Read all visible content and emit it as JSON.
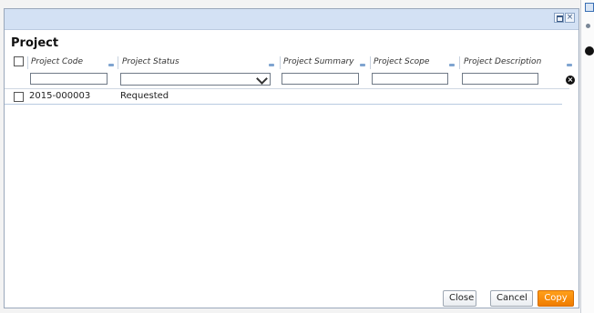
{
  "dialog": {
    "title": "Project",
    "window_buttons": {
      "maximize": "",
      "close": "×"
    }
  },
  "grid": {
    "columns": [
      {
        "label": "Project Code",
        "filter_type": "text",
        "filter_value": ""
      },
      {
        "label": "Project Status",
        "filter_type": "select",
        "filter_value": ""
      },
      {
        "label": "Project Summary",
        "filter_type": "text",
        "filter_value": ""
      },
      {
        "label": "Project Scope",
        "filter_type": "text",
        "filter_value": ""
      },
      {
        "label": "Project Description",
        "filter_type": "text",
        "filter_value": ""
      }
    ],
    "rows": [
      {
        "selected": false,
        "project_code": "2015-000003",
        "project_status": "Requested"
      }
    ],
    "clear_filters_icon": "×"
  },
  "footer": {
    "close_label": "Close",
    "cancel_label": "Cancel",
    "copy_label": "Copy"
  },
  "colors": {
    "titlebar": "#d3e1f4",
    "accent": "#f07c00",
    "row_rule": "#b8cae0"
  }
}
